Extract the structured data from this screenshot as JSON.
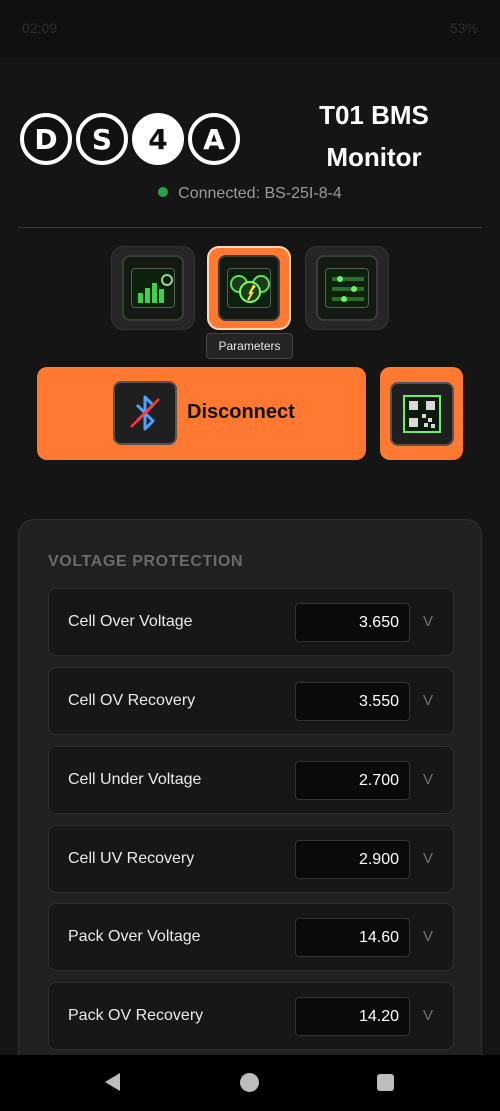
{
  "status": {
    "time": "02:09",
    "battery": "53%"
  },
  "header": {
    "logo_letters": [
      "D",
      "S",
      "4",
      "A"
    ],
    "title": "T01 BMS Monitor",
    "connection_text": "Connected: BS-25I-8-4",
    "connection_color": "#22a34a"
  },
  "nav": {
    "tabs": [
      {
        "name": "dashboard",
        "icon": "dashboard-monitor-icon"
      },
      {
        "name": "parameters",
        "icon": "gauges-icon",
        "active": true
      },
      {
        "name": "settings",
        "icon": "sliders-icon"
      }
    ],
    "tooltip": "Parameters"
  },
  "actions": {
    "disconnect_label": "Disconnect",
    "disconnect_icon": "bluetooth-icon",
    "qr_icon": "qr-code-icon",
    "accent": "#ff7a30"
  },
  "voltage_protection": {
    "title": "VOLTAGE PROTECTION",
    "rows": [
      {
        "label": "Cell Over Voltage",
        "value": "3.650",
        "unit": "V"
      },
      {
        "label": "Cell OV Recovery",
        "value": "3.550",
        "unit": "V"
      },
      {
        "label": "Cell Under Voltage",
        "value": "2.700",
        "unit": "V"
      },
      {
        "label": "Cell UV Recovery",
        "value": "2.900",
        "unit": "V"
      },
      {
        "label": "Pack Over Voltage",
        "value": "14.60",
        "unit": "V"
      },
      {
        "label": "Pack OV Recovery",
        "value": "14.20",
        "unit": "V"
      }
    ]
  }
}
